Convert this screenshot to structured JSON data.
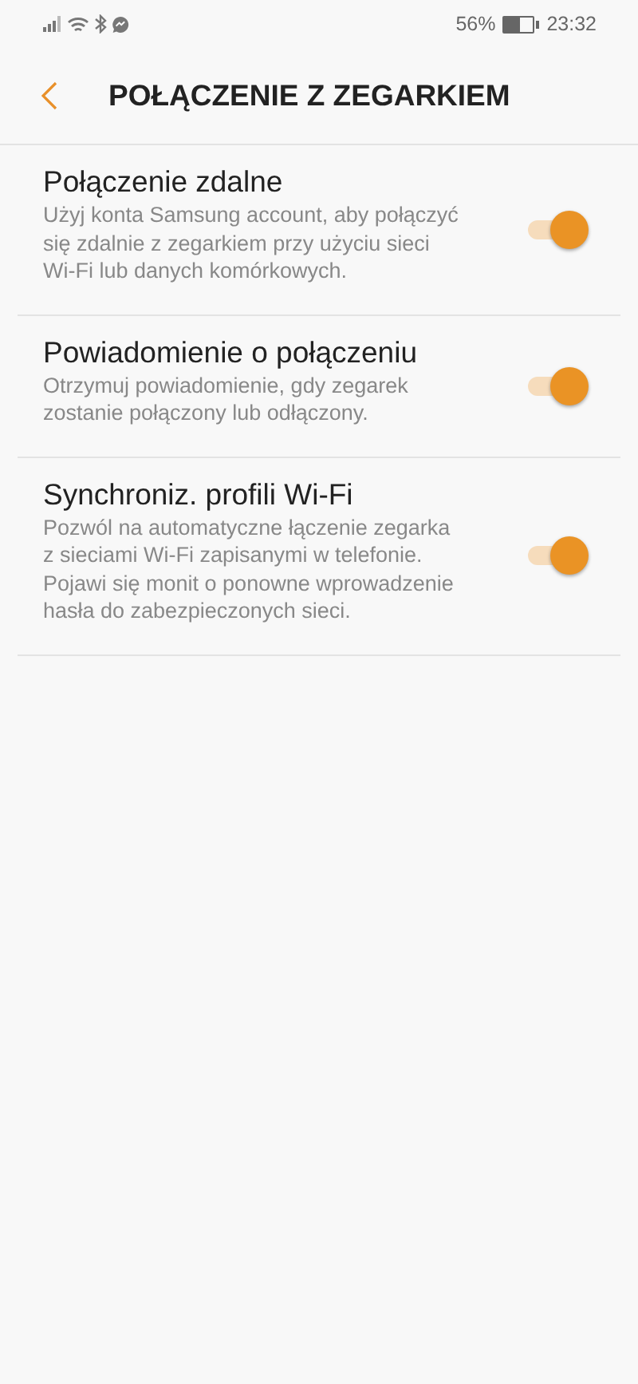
{
  "status_bar": {
    "battery_text": "56%",
    "time": "23:32"
  },
  "header": {
    "title": "POŁĄCZENIE Z ZEGARKIEM"
  },
  "settings": [
    {
      "title": "Połączenie zdalne",
      "description": "Użyj konta Samsung account, aby połączyć się zdalnie z zegarkiem przy użyciu sieci Wi-Fi lub danych komórkowych.",
      "on": true
    },
    {
      "title": "Powiadomienie o połączeniu",
      "description": "Otrzymuj powiadomienie, gdy zegarek zostanie połączony lub odłączony.",
      "on": true
    },
    {
      "title": "Synchroniz. profili Wi-Fi",
      "description": "Pozwól na automatyczne łączenie zegarka z sieciami Wi-Fi zapisanymi w telefonie. Pojawi się monit o ponowne wprowadzenie hasła do zabezpieczonych sieci.",
      "on": true
    }
  ]
}
